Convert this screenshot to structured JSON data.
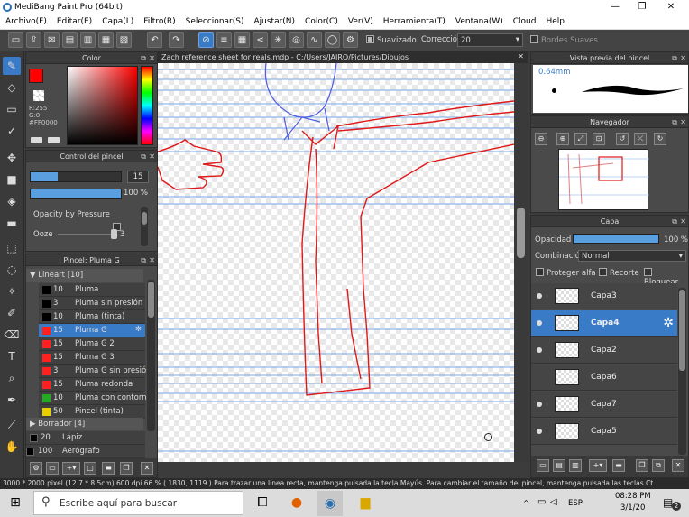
{
  "window": {
    "title": "MediBang Paint Pro (64bit)",
    "minimize": "—",
    "maximize": "❐",
    "close": "✕"
  },
  "menu": [
    "Archivo(F)",
    "Editar(E)",
    "Capa(L)",
    "Filtro(R)",
    "Seleccionar(S)",
    "Ajustar(N)",
    "Color(C)",
    "Ver(V)",
    "Herramienta(T)",
    "Ventana(W)",
    "Cloud",
    "Help"
  ],
  "toolbar": {
    "suavizado_label": "Suavizado",
    "correccion_label": "Corrección",
    "correccion_value": "20",
    "bordes_label": "Bordes Suaves"
  },
  "color_panel": {
    "title": "Color",
    "r": "R:255",
    "g": "G:0",
    "b": "B:0",
    "hex": "#FF0000",
    "primary": "#ff0000"
  },
  "brush_control": {
    "title": "Control del pincel",
    "size_value": "15",
    "size_fraction": 0.3,
    "opacity_label": "100 %",
    "opacity_fraction": 1.0,
    "pressure_label": "Opacity by Pressure",
    "ooze_label": "Ooze",
    "ooze_value": "3"
  },
  "brush_panel": {
    "title": "Pincel: Pluma G",
    "group1": "Lineart [10]",
    "items": [
      {
        "color": "#000000",
        "size": "10",
        "name": "Pluma"
      },
      {
        "color": "#000000",
        "size": "3",
        "name": "Pluma sin presión"
      },
      {
        "color": "#000000",
        "size": "10",
        "name": "Pluma (tinta)"
      },
      {
        "color": "#ff2020",
        "size": "15",
        "name": "Pluma G",
        "selected": true
      },
      {
        "color": "#ff2020",
        "size": "15",
        "name": "Pluma G 2"
      },
      {
        "color": "#ff2020",
        "size": "15",
        "name": "Pluma G 3"
      },
      {
        "color": "#ff2020",
        "size": "3",
        "name": "Pluma G sin presió"
      },
      {
        "color": "#ff2020",
        "size": "15",
        "name": "Pluma redonda"
      },
      {
        "color": "#22aa22",
        "size": "10",
        "name": "Pluma con contorn"
      },
      {
        "color": "#e8d000",
        "size": "50",
        "name": "Pincel (tinta)"
      }
    ],
    "group2": "Borrador [4]",
    "extra": [
      {
        "size": "20",
        "name": "Lápiz"
      },
      {
        "size": "100",
        "name": "Aerógrafo"
      }
    ]
  },
  "document_tab": "Zach reference sheet for reals.mdp - C:/Users/JAIRO/Pictures/Dibujos",
  "preview_panel": {
    "title": "Vista previa del pincel",
    "size": "0.64mm"
  },
  "navigator_panel": {
    "title": "Navegador"
  },
  "layer_panel": {
    "title": "Capa",
    "opacity_label": "Opacidad",
    "opacity_value": "100 %",
    "opacity_fraction": 1.0,
    "blend_label": "Combinación",
    "blend_value": "Normal",
    "protect_label": "Proteger alfa",
    "clip_label": "Recorte",
    "lock_label": "Bloquear",
    "layers": [
      {
        "name": "Capa3",
        "visible": true,
        "selected": false
      },
      {
        "name": "Capa4",
        "visible": true,
        "selected": true
      },
      {
        "name": "Capa2",
        "visible": true,
        "selected": false
      },
      {
        "name": "Capa6",
        "visible": false,
        "selected": false
      },
      {
        "name": "Capa7",
        "visible": true,
        "selected": false
      },
      {
        "name": "Capa5",
        "visible": true,
        "selected": false
      }
    ]
  },
  "status": "3000 * 2000 pixel  (12.7 * 8.5cm)  600 dpi  66 %  ( 1830, 1119 )  Para trazar una línea recta, mantenga pulsada la tecla Mayús. Para cambiar el tamaño del pincel, mantenga pulsada las teclas Ct",
  "taskbar": {
    "search_placeholder": "Escribe aquí para buscar",
    "lang": "ESP",
    "time": "08:28 PM",
    "date": "3/1/20",
    "notif_count": "2"
  }
}
